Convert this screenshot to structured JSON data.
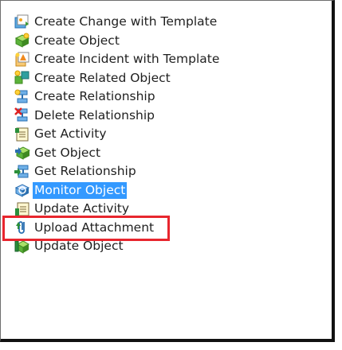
{
  "items": [
    {
      "label": "Create Change with Template",
      "icon": "template-change-icon"
    },
    {
      "label": "Create Object",
      "icon": "create-object-icon"
    },
    {
      "label": "Create Incident with Template",
      "icon": "template-incident-icon"
    },
    {
      "label": "Create Related Object",
      "icon": "create-related-object-icon"
    },
    {
      "label": "Create Relationship",
      "icon": "create-relationship-icon"
    },
    {
      "label": "Delete Relationship",
      "icon": "delete-relationship-icon"
    },
    {
      "label": "Get Activity",
      "icon": "get-activity-icon"
    },
    {
      "label": "Get Object",
      "icon": "get-object-icon"
    },
    {
      "label": "Get Relationship",
      "icon": "get-relationship-icon"
    },
    {
      "label": "Monitor Object",
      "icon": "monitor-object-icon"
    },
    {
      "label": "Update Activity",
      "icon": "update-activity-icon"
    },
    {
      "label": "Upload Attachment",
      "icon": "upload-attachment-icon"
    },
    {
      "label": "Update Object",
      "icon": "update-object-icon"
    }
  ],
  "selected_label": "Monitor Object",
  "colors": {
    "selection": "#3399ff",
    "highlight_border": "#e8262e"
  }
}
